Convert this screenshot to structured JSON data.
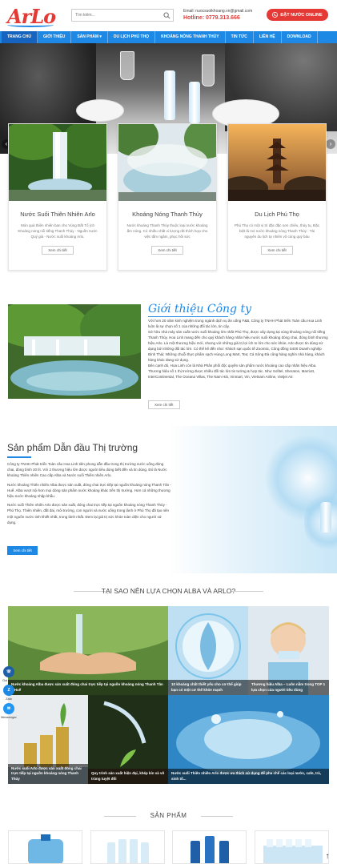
{
  "header": {
    "logo_text": "ArLo",
    "search_placeholder": "Tìm kiếm...",
    "email": "Email: nuocsuoikhoang.vn@gmail.com",
    "hotline": "Hotline: 0779.313.666",
    "order_button": "ĐẶT NƯỚC ONLINE"
  },
  "nav": {
    "items": [
      {
        "label": "TRANG CHỦ",
        "active": true
      },
      {
        "label": "GIỚI THIỆU"
      },
      {
        "label": "SẢN PHẨM ▾"
      },
      {
        "label": "DU LỊCH PHÚ THỌ"
      },
      {
        "label": "KHOÁNG NÓNG THANH THỦY"
      },
      {
        "label": "TIN TỨC"
      },
      {
        "label": "LIÊN HỆ"
      },
      {
        "label": "DOWNLOAD"
      }
    ]
  },
  "features": [
    {
      "title": "Nước Suối Thiên Nhiên Arlo",
      "desc": "Món quà thiên nhiên ban cho Vùng Đất Tổ (ch Khoáng nóng nổi tiếng Thanh Thủy - Nguồn nước Quý giá - Nước suối khoáng Arlo.",
      "button": "Xem chi tiết"
    },
    {
      "title": "Khoáng Nóng Thanh Thủy",
      "desc": "Nước khoáng Thanh Thủy thuộc loại nước khoáng ấm nóng. Có nhiều chất vi lượng rất thích hợp cho việc tắm ngâm, phục hồi sức",
      "button": "Xem chi tiết"
    },
    {
      "title": "Du Lịch Phú Thọ",
      "desc": "Phú Thọ có một vị trí đặc đặc sơn chiêu, thủy tụ, Đặc biệt là mỏ nước khoáng nóng Thanh Thủy - Tài nguyên du lịch tự nhiên vô cùng quý báu",
      "button": "Xem chi tiết"
    }
  ],
  "intro": {
    "title": "Giới thiệu Công ty",
    "paragraphs": [
      "Với hơn 20 năm kinh nghiệm trong ngành dịch vụ ăn uống F&B, Công ty TNHH Phát triển Toàn cầu Hoa Linh luôn là sự chọn số 1 của những đối tác lớn, tin cậy.",
      "Sở hữu nhà máy sản xuất nước suối khoáng lớn nhất Phú Thọ, được xây dựng tại vùng khoáng nóng nổi tiếng Thanh Thủy. Hoa Linh mang đến cho quý khách hàng nhãn hiệu nước suối khoáng đóng chai, đóng bình thương hiệu Arlo. Là một thương hiệu mới, nhưng với những giá trị lợi ích to lớn cho sức khỏe, Arlo được tin dùng sử dụng bởi những đối tác lớn. Có thể kể đến như: Khách sạn quốc tế Zoomtic, Công đồng S400 Doanh nghiệp Bình Thái; Những chuỗi thực phẩm sạch Hùng Long Mart, Tea; Cả Sông Đà cũng hàng nghìn nhà hàng, khách hàng khác đang sử dụng.",
      "Bên cạnh đó, Hoa Linh còn là Nhà Phân phối độc quyền sản phẩm nước khoáng cao cấp nhãn hiệu Alba. Thương hiệu số 1 thị trường được nhiều đối tác lớn tin tưởng & hợp tác. Như Sofitel, Sheraton, Marriott, InterContinental, The Oceana Villas, The Nam Hải, Vinmart, Vin, Vietnam Airline, Vietjet Air."
    ],
    "button": "Xem chi tiết"
  },
  "lead": {
    "title": "Sản phẩm Dẫn đầu Thị trường",
    "paragraphs": [
      "Công ty TNHH Phát triển Toàn cầu Hoa Linh tiên phong dẫn đầu trong thị trường nước uống đóng chai, đóng bình 20 lít. Với 2 thương hiệu lớn được người tiêu dùng biết đến và tin dùng. Đó là Nước khoáng Thiên nhiên Cao cấp Alba và Nước suối Thiên nhiên Arlo.",
      "Nước khoáng Thiên nhiên Alba được sản xuất, đóng chai trực tiếp tại nguồn khoáng nóng Thanh Tân - Huế. Alba vượt nội hơn mọi dòng sản phẩm nước khoáng khác trên thị trường. Hơn cả những thương hiệu nước khoáng nhập khẩu.",
      "Nước suối Thiên nhiên Arlo được sản xuất, đóng chai trực tiếp tại nguồn khoáng nóng Thanh Thủy - Phú Thọ. Thiên nhiên, đất đai, môi trường, con người và nước uống trong lành ở Phú Thọ đã tạo nên một nguồn nước tinh khiết nhất, trong lành nhất. Đem lại giá trị sức khỏe toàn diện cho người sử dụng."
    ],
    "button": "Xem chi tiết"
  },
  "why": {
    "title": "TẠI SAO NÊN LỰA CHỌN ALBA VÀ ARLO?",
    "tiles": [
      "Nước khoáng Alba được sản xuất đóng chai trực tiếp tại nguồn khoáng nóng Thanh Tân – Huế",
      "10 khoáng chất thiết yếu cho cơ thể giúp bạn có một cơ thể khỏe mạnh",
      "Thương hiệu Alba – Luôn nằm trong TOP 1 lựa chọn của người tiêu dùng",
      "Nước suối Arlo được sản xuất đóng chai trực tiếp tại nguồn khoáng nóng Thanh Thủy",
      "Quy trình sản xuất hiện đại, khép kín và vô trùng tuyệt đối",
      "Nước suối Thiên nhiên Arlo được ưa thích sử dụng để pha chế các loại nước, cafe, trà, sinh tố..."
    ]
  },
  "products": {
    "title": "SẢN PHẨM"
  },
  "floating": {
    "call": "Gọi ngay",
    "zalo": "Zalo",
    "messenger": "Messenger"
  },
  "colors": {
    "primary": "#1e88e5",
    "accent": "#e53935"
  }
}
